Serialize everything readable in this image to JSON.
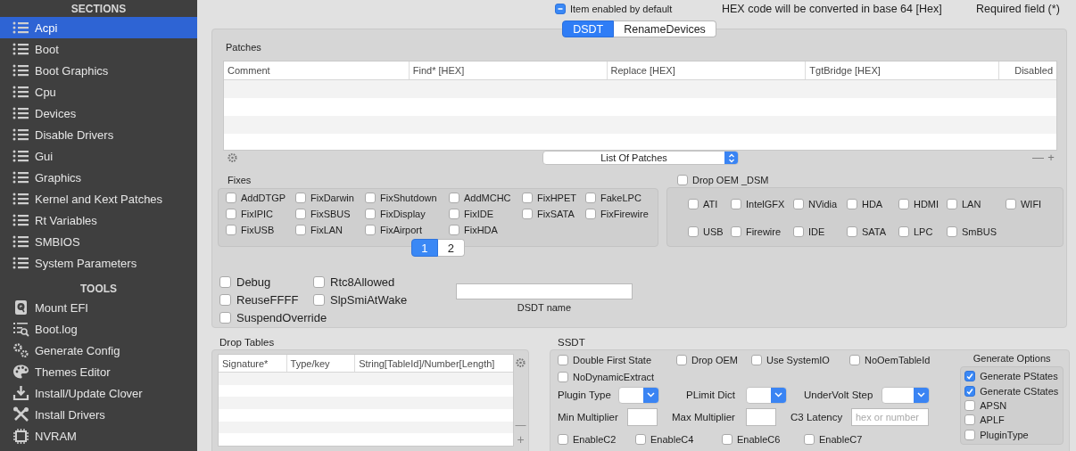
{
  "sidebar": {
    "sections_title": "SECTIONS",
    "sections": [
      {
        "label": "Acpi",
        "selected": true
      },
      {
        "label": "Boot",
        "selected": false
      },
      {
        "label": "Boot Graphics",
        "selected": false
      },
      {
        "label": "Cpu",
        "selected": false
      },
      {
        "label": "Devices",
        "selected": false
      },
      {
        "label": "Disable Drivers",
        "selected": false
      },
      {
        "label": "Gui",
        "selected": false
      },
      {
        "label": "Graphics",
        "selected": false
      },
      {
        "label": "Kernel and Kext Patches",
        "selected": false
      },
      {
        "label": "Rt Variables",
        "selected": false
      },
      {
        "label": "SMBIOS",
        "selected": false
      },
      {
        "label": "System Parameters",
        "selected": false
      }
    ],
    "tools_title": "TOOLS",
    "tools": [
      {
        "label": "Mount EFI"
      },
      {
        "label": "Boot.log"
      },
      {
        "label": "Generate Config"
      },
      {
        "label": "Themes Editor"
      },
      {
        "label": "Install/Update Clover"
      },
      {
        "label": "Install Drivers"
      },
      {
        "label": "NVRAM"
      }
    ]
  },
  "header": {
    "item_enabled": {
      "label": "Item enabled by default",
      "mixed": true
    },
    "hex_note": "HEX code will be converted in base 64 [Hex]",
    "required_note": "Required field (*)"
  },
  "tabs": [
    {
      "label": "DSDT",
      "selected": true
    },
    {
      "label": "RenameDevices",
      "selected": false
    }
  ],
  "patches": {
    "title": "Patches",
    "columns": [
      "Comment",
      "Find* [HEX]",
      "Replace [HEX]",
      "TgtBridge [HEX]",
      "Disabled"
    ],
    "popup": "List Of Patches",
    "remove": "—",
    "add": "+"
  },
  "fixes": {
    "title": "Fixes",
    "items": [
      {
        "label": "AddDTGP",
        "checked": false
      },
      {
        "label": "FixDarwin",
        "checked": false
      },
      {
        "label": "FixShutdown",
        "checked": false
      },
      {
        "label": "AddMCHC",
        "checked": false
      },
      {
        "label": "FixHPET",
        "checked": false
      },
      {
        "label": "FakeLPC",
        "checked": false
      },
      {
        "label": "FixIPIC",
        "checked": false
      },
      {
        "label": "FixSBUS",
        "checked": false
      },
      {
        "label": "FixDisplay",
        "checked": false
      },
      {
        "label": "FixIDE",
        "checked": false
      },
      {
        "label": "FixSATA",
        "checked": false
      },
      {
        "label": "FixFirewire",
        "checked": false
      },
      {
        "label": "FixUSB",
        "checked": false
      },
      {
        "label": "FixLAN",
        "checked": false
      },
      {
        "label": "FixAirport",
        "checked": false
      },
      {
        "label": "FixHDA",
        "checked": false
      }
    ],
    "pages": [
      {
        "label": "1",
        "selected": true
      },
      {
        "label": "2",
        "selected": false
      }
    ]
  },
  "drop_oem_dsm": {
    "label": "Drop OEM _DSM",
    "checked": false,
    "items": [
      {
        "label": "ATI",
        "checked": false
      },
      {
        "label": "IntelGFX",
        "checked": false
      },
      {
        "label": "NVidia",
        "checked": false
      },
      {
        "label": "HDA",
        "checked": false
      },
      {
        "label": "HDMI",
        "checked": false
      },
      {
        "label": "LAN",
        "checked": false
      },
      {
        "label": "WIFI",
        "checked": false
      },
      {
        "label": "USB",
        "checked": false
      },
      {
        "label": "Firewire",
        "checked": false
      },
      {
        "label": "IDE",
        "checked": false
      },
      {
        "label": "SATA",
        "checked": false
      },
      {
        "label": "LPC",
        "checked": false
      },
      {
        "label": "SmBUS",
        "checked": false
      }
    ]
  },
  "options": [
    {
      "label": "Debug",
      "checked": false
    },
    {
      "label": "Rtc8Allowed",
      "checked": false
    },
    {
      "label": "ReuseFFFF",
      "checked": false
    },
    {
      "label": "SlpSmiAtWake",
      "checked": false
    },
    {
      "label": "SuspendOverride",
      "checked": false
    }
  ],
  "dsdt_name": {
    "label": "DSDT name"
  },
  "drop_tables": {
    "title": "Drop Tables",
    "columns": [
      "Signature*",
      "Type/key",
      "String[TableId]/Number[Length]"
    ],
    "remove": "—",
    "add": "+"
  },
  "ssdt": {
    "title": "SSDT",
    "checks": [
      {
        "label": "Double First State",
        "checked": false
      },
      {
        "label": "Drop OEM",
        "checked": false
      },
      {
        "label": "Use SystemIO",
        "checked": false
      },
      {
        "label": "NoOemTableId",
        "checked": false
      },
      {
        "label": "NoDynamicExtract",
        "checked": false
      }
    ],
    "popups": [
      {
        "label": "Plugin Type"
      },
      {
        "label": "PLimit Dict"
      },
      {
        "label": "UnderVolt Step"
      }
    ],
    "fields": [
      {
        "label": "Min Multiplier"
      },
      {
        "label": "Max Multiplier"
      },
      {
        "label": "C3 Latency",
        "placeholder": "hex or number"
      }
    ],
    "c_states": [
      {
        "label": "EnableC2",
        "checked": false
      },
      {
        "label": "EnableC4",
        "checked": false
      },
      {
        "label": "EnableC6",
        "checked": false
      },
      {
        "label": "EnableC7",
        "checked": false
      }
    ],
    "generate_options": {
      "title": "Generate Options",
      "items": [
        {
          "label": "Generate PStates",
          "checked": true
        },
        {
          "label": "Generate CStates",
          "checked": true
        },
        {
          "label": "APSN",
          "checked": false
        },
        {
          "label": "APLF",
          "checked": false
        },
        {
          "label": "PluginType",
          "checked": false
        }
      ]
    }
  }
}
